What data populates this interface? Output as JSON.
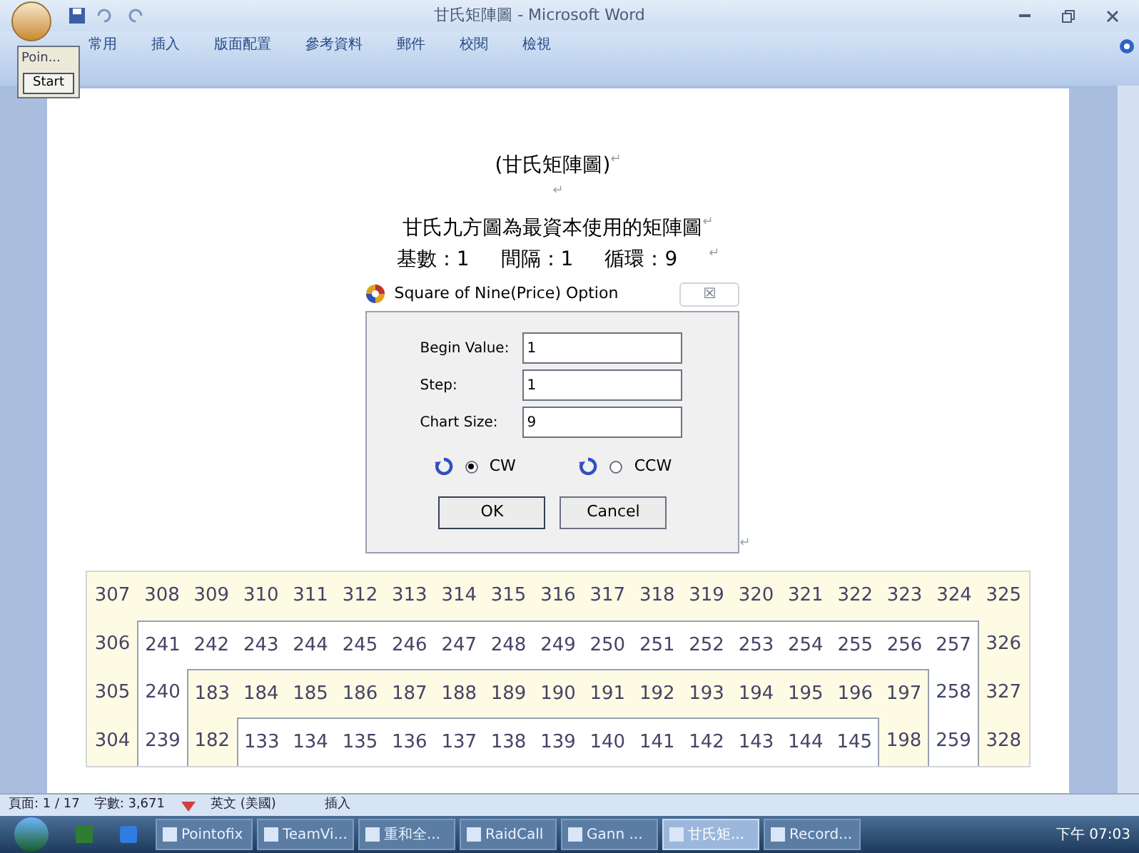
{
  "window": {
    "title": "甘氏矩陣圖 - Microsoft Word"
  },
  "ribbon_tabs": [
    {
      "label": "常用"
    },
    {
      "label": "插入"
    },
    {
      "label": "版面配置"
    },
    {
      "label": "參考資料"
    },
    {
      "label": "郵件"
    },
    {
      "label": "校閱"
    },
    {
      "label": "檢視"
    }
  ],
  "floating_tool": {
    "title": "Poin...",
    "button": "Start"
  },
  "document": {
    "paragraphs": [
      {
        "text": "(甘氏矩陣圖)",
        "mark": "↵"
      },
      {
        "mark": "↵"
      },
      {
        "text": "甘氏九方圖為最資本使用的矩陣圖",
        "mark": "↵"
      }
    ],
    "params": [
      {
        "label": "基數：",
        "value": "1"
      },
      {
        "label": "間隔：",
        "value": "1"
      },
      {
        "label": "循環：",
        "value": "9"
      }
    ],
    "params_mark": "↵",
    "dialog_mark": "↵"
  },
  "dialog": {
    "title": "Square of Nine(Price) Option",
    "close": "☒",
    "fields": [
      {
        "label": "Begin Value:",
        "value": "1"
      },
      {
        "label": "Step:",
        "value": "1"
      },
      {
        "label": "Chart Size:",
        "value": "9"
      }
    ],
    "radios": [
      {
        "label": "CW",
        "selected": true
      },
      {
        "label": "CCW",
        "selected": false
      }
    ],
    "buttons": [
      "OK",
      "Cancel"
    ]
  },
  "table": {
    "rows": [
      [
        "307",
        "308",
        "309",
        "310",
        "311",
        "312",
        "313",
        "314",
        "315",
        "316",
        "317",
        "318",
        "319",
        "320",
        "321",
        "322",
        "323",
        "324",
        "325"
      ],
      [
        "306",
        "241",
        "242",
        "243",
        "244",
        "245",
        "246",
        "247",
        "248",
        "249",
        "250",
        "251",
        "252",
        "253",
        "254",
        "255",
        "256",
        "257",
        "326"
      ],
      [
        "305",
        "240",
        "183",
        "184",
        "185",
        "186",
        "187",
        "188",
        "189",
        "190",
        "191",
        "192",
        "193",
        "194",
        "195",
        "196",
        "197",
        "258",
        "327"
      ],
      [
        "304",
        "239",
        "182",
        "133",
        "134",
        "135",
        "136",
        "137",
        "138",
        "139",
        "140",
        "141",
        "142",
        "143",
        "144",
        "145",
        "198",
        "259",
        "328"
      ]
    ]
  },
  "status_bar": {
    "page": "頁面: 1 / 17",
    "words": "字數: 3,671",
    "language": "英文 (美國)",
    "mode": "插入"
  },
  "taskbar": {
    "items": [
      {
        "label": "Pointofix",
        "selected": false
      },
      {
        "label": "TeamVi...",
        "selected": false
      },
      {
        "label": "重和全...",
        "selected": false
      },
      {
        "label": "RaidCall",
        "selected": false
      },
      {
        "label": "Gann ...",
        "selected": false
      },
      {
        "label": "甘氏矩...",
        "selected": true
      },
      {
        "label": "Record...",
        "selected": false
      }
    ],
    "clock": "下午 07:03"
  }
}
